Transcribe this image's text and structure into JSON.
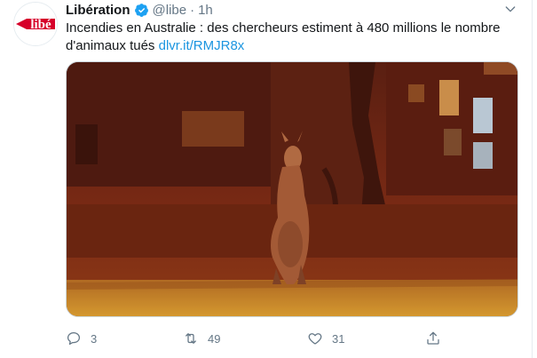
{
  "tweet": {
    "author_name": "Libération",
    "handle": "@libe",
    "separator": "·",
    "time": "1h",
    "text": "Incendies en Australie : des chercheurs estiment à 480 millions le nombre d'animaux tués",
    "link": "dlvr.it/RMJR8x",
    "avatar_logo_text": "libé"
  },
  "actions": {
    "reply_count": "3",
    "retweet_count": "49",
    "like_count": "31"
  },
  "colors": {
    "link": "#1b95e0",
    "verified": "#1da1f2",
    "logo_red": "#d6002a",
    "muted": "#657786"
  },
  "icons": {
    "verified": "verified-badge-icon",
    "caret": "chevron-down-icon",
    "reply": "reply-icon",
    "retweet": "retweet-icon",
    "like": "heart-icon",
    "share": "share-icon"
  }
}
